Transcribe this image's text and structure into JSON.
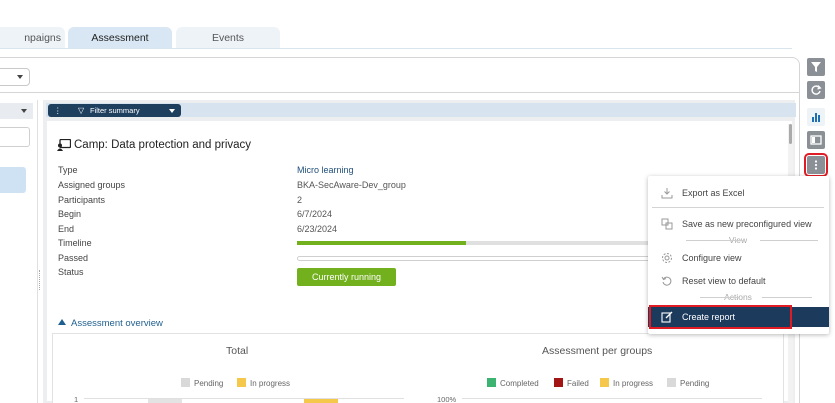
{
  "tabs": [
    {
      "label": "Campaigns",
      "visible": "npaigns"
    },
    {
      "label": "Assessment"
    },
    {
      "label": "Events"
    }
  ],
  "filter": {
    "label": "Filter summary"
  },
  "campaign": {
    "title": "Camp: Data protection and privacy",
    "rows": [
      {
        "label": "Type",
        "value": "Micro learning"
      },
      {
        "label": "Assigned groups",
        "value": "BKA-SecAware-Dev_group"
      },
      {
        "label": "Participants",
        "value": "2"
      },
      {
        "label": "Begin",
        "value": "6/7/2024"
      },
      {
        "label": "End",
        "value": "6/23/2024"
      },
      {
        "label": "Timeline",
        "value": ""
      },
      {
        "label": "Passed",
        "value": ""
      },
      {
        "label": "Status",
        "value": ""
      }
    ],
    "timeline_progress": 0.47,
    "status": "Currently running"
  },
  "overview": {
    "label": "Assessment overview"
  },
  "charts": {
    "total": {
      "title": "Total",
      "legend": [
        {
          "label": "Pending",
          "color": "#d9d9d9"
        },
        {
          "label": "In progress",
          "color": "#f5c84c"
        }
      ],
      "y_top_tick": "1"
    },
    "groups": {
      "title": "Assessment per groups",
      "legend": [
        {
          "label": "Completed",
          "color": "#3cb371"
        },
        {
          "label": "Failed",
          "color": "#a31515"
        },
        {
          "label": "In progress",
          "color": "#f5c84c"
        },
        {
          "label": "Pending",
          "color": "#d9d9d9"
        }
      ],
      "y_top_tick": "100%"
    }
  },
  "menu": {
    "export_excel": "Export as Excel",
    "save_view": "Save as new preconfigured view",
    "section_view": "View",
    "configure_view": "Configure view",
    "reset_view": "Reset view to default",
    "section_actions": "Actions",
    "create_report": "Create report"
  },
  "toolbar": {
    "icons": [
      "filter-icon",
      "refresh-icon",
      "bar-chart-icon",
      "panel-icon",
      "more-vertical-icon"
    ]
  },
  "colors": {
    "accent_dark": "#1c3a5c",
    "success": "#73b01e",
    "highlight": "#e01b24"
  }
}
